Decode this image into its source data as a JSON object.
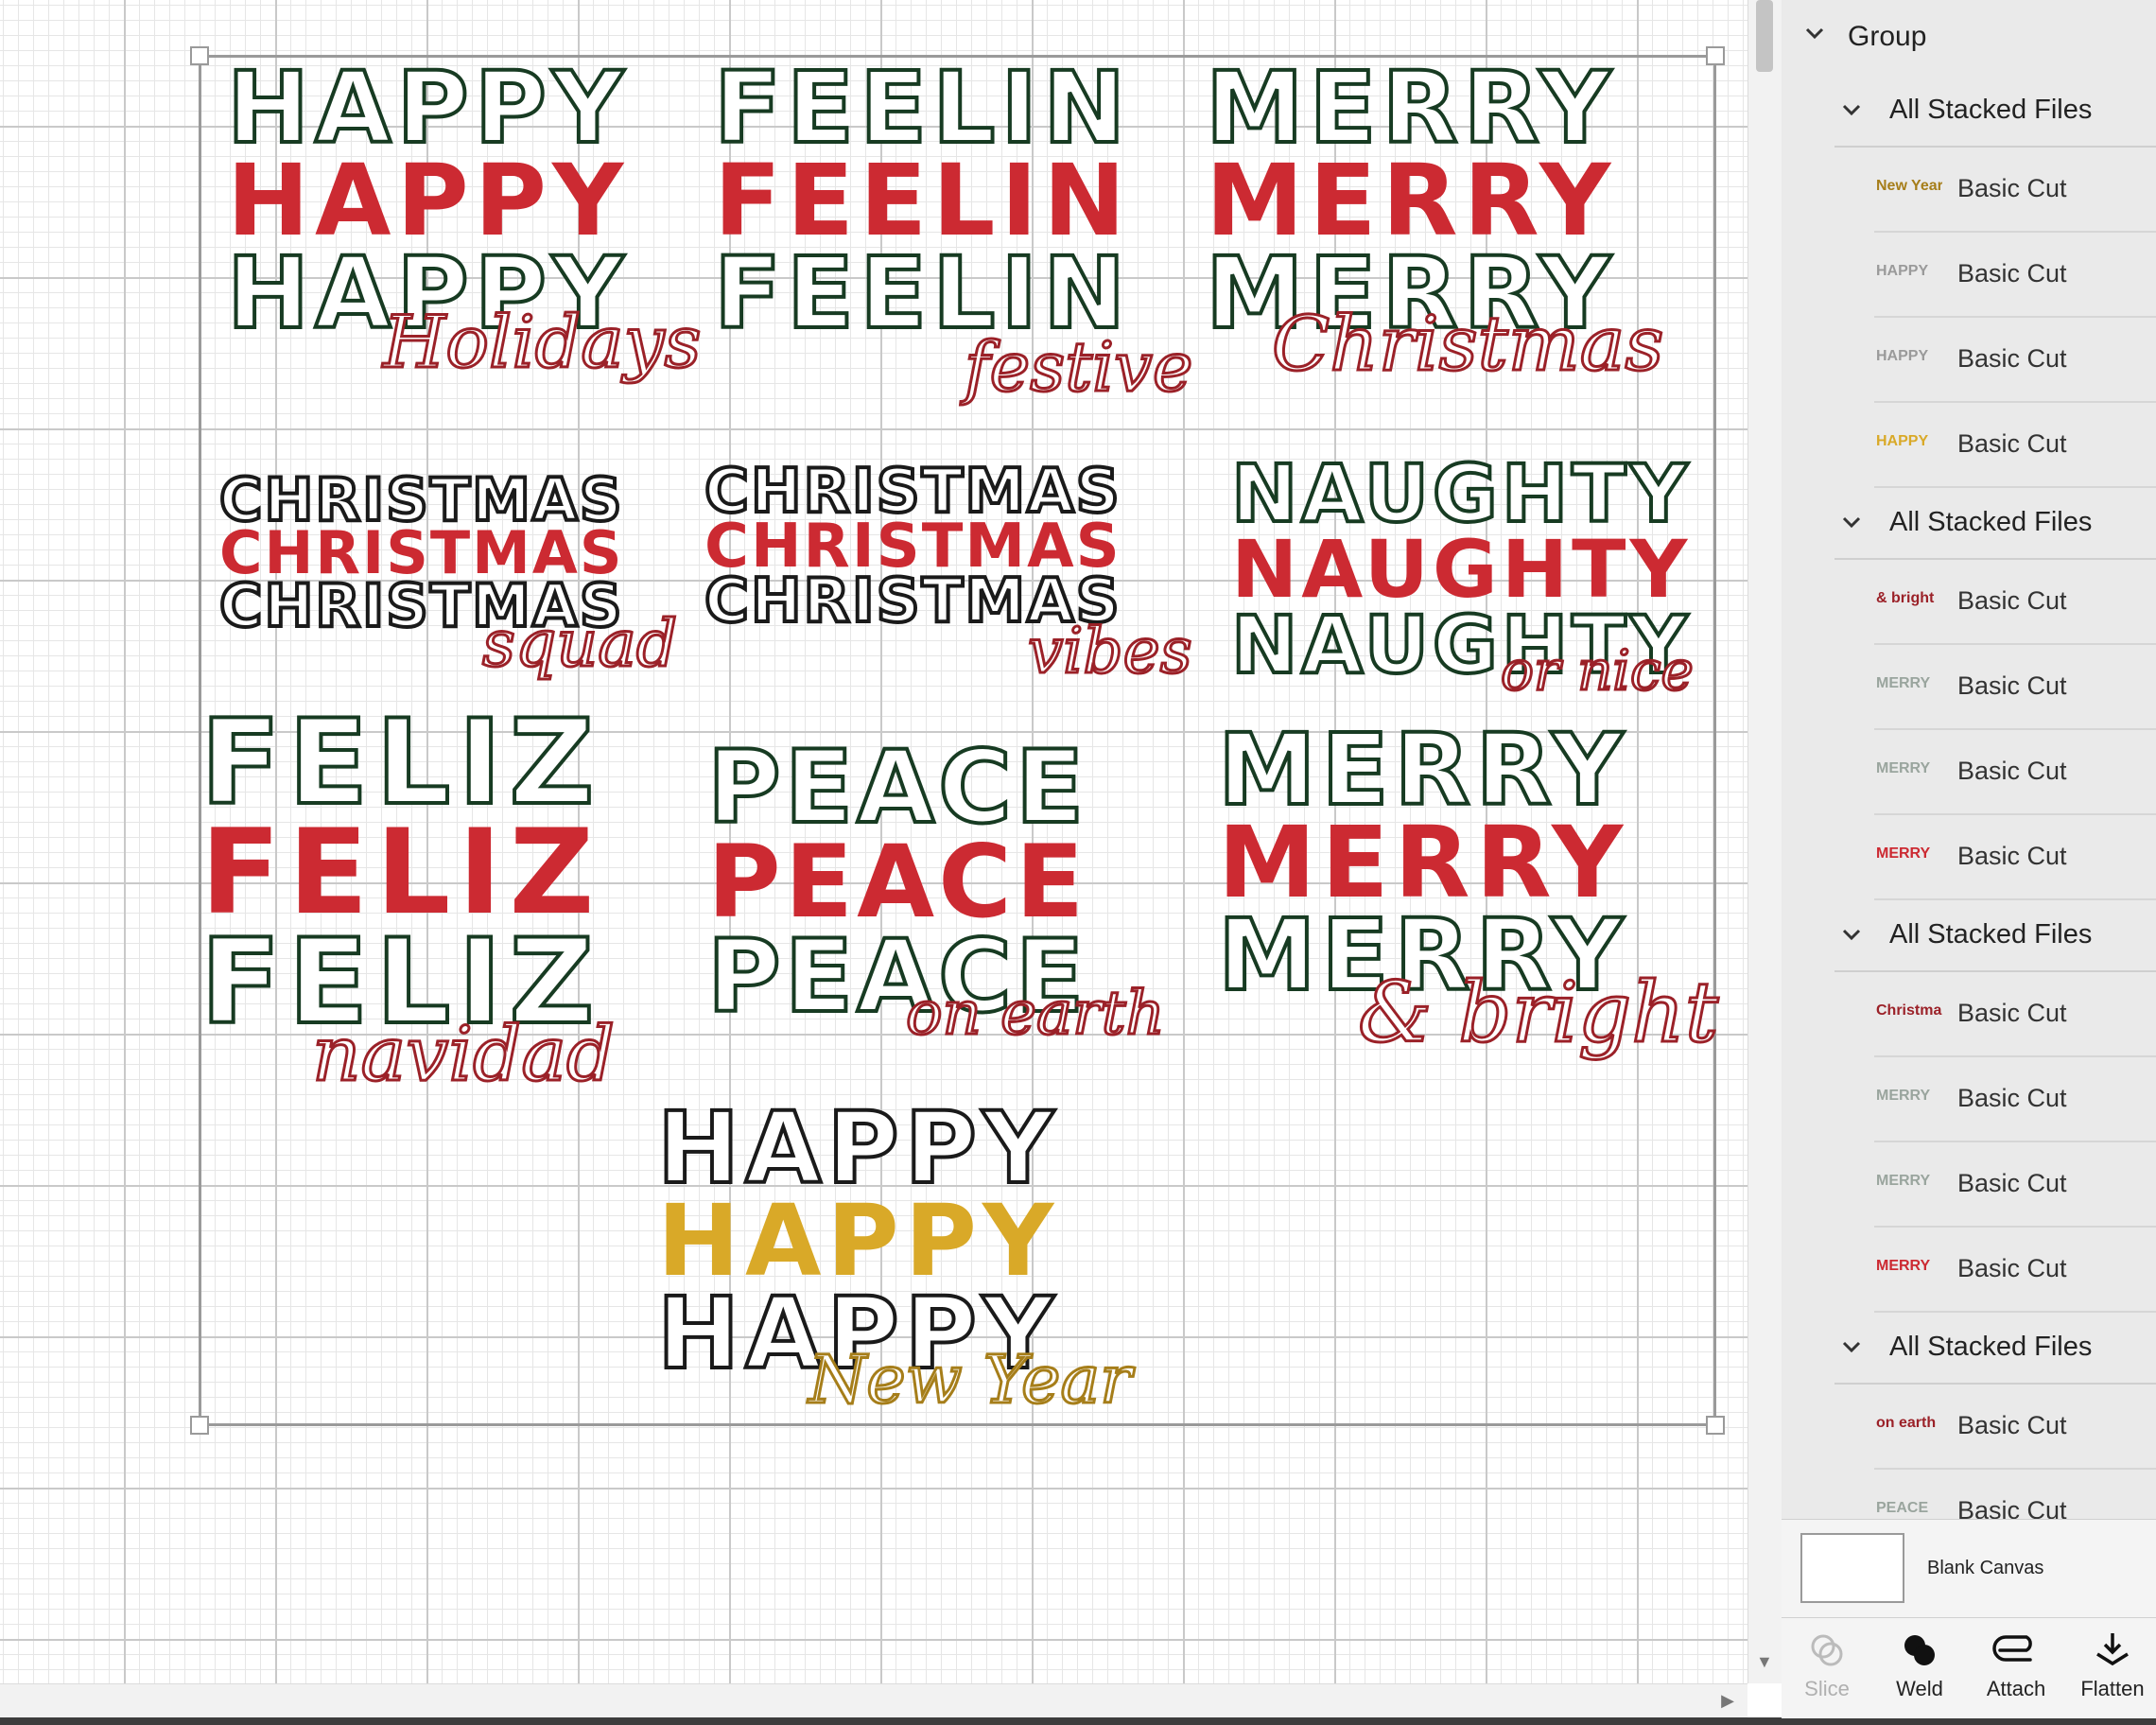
{
  "canvas": {
    "designs": [
      {
        "words": [
          "HAPPY",
          "HAPPY",
          "HAPPY"
        ],
        "script": "Holidays",
        "script_color": "red",
        "solid_color": "#cc2a32",
        "outline": "green"
      },
      {
        "words": [
          "FEELIN",
          "FEELIN",
          "FEELIN"
        ],
        "script": "festive",
        "script_color": "red",
        "solid_color": "#cc2a32",
        "outline": "green"
      },
      {
        "words": [
          "MERRY",
          "MERRY",
          "MERRY"
        ],
        "script": "Christmas",
        "script_color": "red",
        "solid_color": "#cc2a32",
        "outline": "green"
      },
      {
        "words": [
          "CHRISTMAS",
          "CHRISTMAS",
          "CHRISTMAS"
        ],
        "script": "squad",
        "script_color": "red",
        "solid_color": "#cc2a32",
        "outline": "black"
      },
      {
        "words": [
          "CHRISTMAS",
          "CHRISTMAS",
          "CHRISTMAS"
        ],
        "script": "vibes",
        "script_color": "red",
        "solid_color": "#cc2a32",
        "outline": "black"
      },
      {
        "words": [
          "NAUGHTY",
          "NAUGHTY",
          "NAUGHTY"
        ],
        "script": "or nice",
        "script_color": "red",
        "solid_color": "#cc2a32",
        "outline": "green"
      },
      {
        "words": [
          "FELIZ",
          "FELIZ",
          "FELIZ"
        ],
        "script": "navidad",
        "script_color": "red",
        "solid_color": "#cc2a32",
        "outline": "green"
      },
      {
        "words": [
          "PEACE",
          "PEACE",
          "PEACE"
        ],
        "script": "on earth",
        "script_color": "red",
        "solid_color": "#cc2a32",
        "outline": "green"
      },
      {
        "words": [
          "MERRY",
          "MERRY",
          "MERRY"
        ],
        "script": "& bright",
        "script_color": "red",
        "solid_color": "#cc2a32",
        "outline": "green"
      },
      {
        "words": [
          "HAPPY",
          "HAPPY",
          "HAPPY"
        ],
        "script": "New Year",
        "script_color": "gold",
        "solid_color": "#d9a928",
        "outline": "black"
      }
    ]
  },
  "layers": {
    "group_label": "Group",
    "stacks": [
      {
        "label": "All Stacked Files",
        "items": [
          {
            "thumb": "New Year",
            "thumb_color": "#a67e1a",
            "label": "Basic Cut"
          },
          {
            "thumb": "HAPPY",
            "thumb_color": "#9a9a9a",
            "label": "Basic Cut"
          },
          {
            "thumb": "HAPPY",
            "thumb_color": "#9a9a9a",
            "label": "Basic Cut"
          },
          {
            "thumb": "HAPPY",
            "thumb_color": "#d9a928",
            "label": "Basic Cut"
          }
        ]
      },
      {
        "label": "All Stacked Files",
        "items": [
          {
            "thumb": "& bright",
            "thumb_color": "#9b2128",
            "label": "Basic Cut"
          },
          {
            "thumb": "MERRY",
            "thumb_color": "#9aa59e",
            "label": "Basic Cut"
          },
          {
            "thumb": "MERRY",
            "thumb_color": "#9aa59e",
            "label": "Basic Cut"
          },
          {
            "thumb": "MERRY",
            "thumb_color": "#cc2a32",
            "label": "Basic Cut"
          }
        ]
      },
      {
        "label": "All Stacked Files",
        "items": [
          {
            "thumb": "Christmas",
            "thumb_color": "#9b2128",
            "label": "Basic Cut"
          },
          {
            "thumb": "MERRY",
            "thumb_color": "#9aa59e",
            "label": "Basic Cut"
          },
          {
            "thumb": "MERRY",
            "thumb_color": "#9aa59e",
            "label": "Basic Cut"
          },
          {
            "thumb": "MERRY",
            "thumb_color": "#cc2a32",
            "label": "Basic Cut"
          }
        ]
      },
      {
        "label": "All Stacked Files",
        "items": [
          {
            "thumb": "on earth",
            "thumb_color": "#9b2128",
            "label": "Basic Cut"
          },
          {
            "thumb": "PEACE",
            "thumb_color": "#9aa59e",
            "label": "Basic Cut"
          }
        ]
      }
    ]
  },
  "blank_canvas": {
    "label": "Blank Canvas"
  },
  "toolbar": {
    "slice_label": "Slice",
    "weld_label": "Weld",
    "attach_label": "Attach",
    "flatten_label": "Flatten"
  }
}
